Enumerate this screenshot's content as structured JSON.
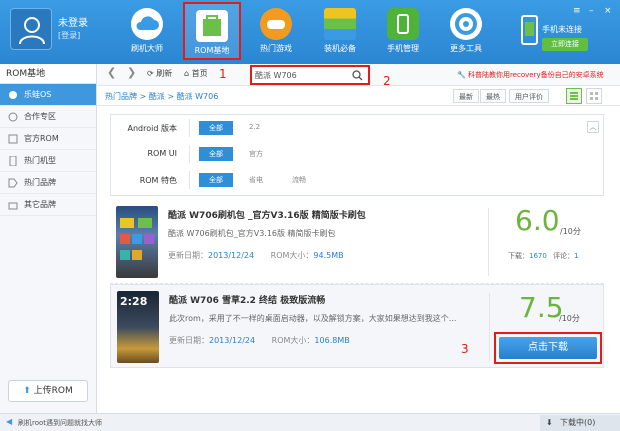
{
  "user": {
    "name": "未登录",
    "login": "[登录]"
  },
  "nav": [
    {
      "label": "刷机大师"
    },
    {
      "label": "ROM基地"
    },
    {
      "label": "热门游戏"
    },
    {
      "label": "装机必备"
    },
    {
      "label": "手机管理"
    },
    {
      "label": "更多工具"
    }
  ],
  "phone": {
    "status": "手机未连接",
    "connect": "立即连接"
  },
  "sidebar": {
    "title": "ROM基地",
    "items": [
      {
        "label": "乐蛙OS"
      },
      {
        "label": "合作专区"
      },
      {
        "label": "官方ROM"
      },
      {
        "label": "热门机型"
      },
      {
        "label": "热门品牌"
      },
      {
        "label": "其它品牌"
      }
    ],
    "upload": "上传ROM"
  },
  "toolbar": {
    "refresh": "刷新",
    "home": "首页",
    "search_value": "酷派 W706",
    "warning": "科普陆教你用recovery备份自己的安卓系统"
  },
  "annotations": {
    "n1": "1",
    "n2": "2",
    "n3": "3"
  },
  "breadcrumb": "热门品牌 > 酷派 > 酷派 W706",
  "sort": {
    "newest": "最新",
    "hottest": "最热",
    "rating": "用户评价"
  },
  "filter": {
    "rows": [
      {
        "label": "Android 版本",
        "selected": "全部",
        "options": [
          "2.2"
        ]
      },
      {
        "label": "ROM UI",
        "selected": "全部",
        "options": [
          "官方"
        ]
      },
      {
        "label": "ROM 特色",
        "selected": "全部",
        "options": [
          "省电",
          "流畅"
        ]
      }
    ]
  },
  "roms": [
    {
      "title": "酷派 W706刷机包 _官方V3.16版 精简版卡刷包",
      "desc": "酷派 W706刷机包_官方V3.16版 精简版卡刷包",
      "date_label": "更新日期：",
      "date": "2013/12/24",
      "size_label": "ROM大小：",
      "size": "94.5MB",
      "score": "6.0",
      "score_unit": "/10分",
      "downloads_label": "下载：",
      "downloads": "1670",
      "comments_label": "评论：",
      "comments": "1"
    },
    {
      "title": "酷派 W706 雪草2.2 终结 极致版流畅",
      "desc": "此次rom，采用了不一样的桌面启动器，以及解锁方案，大家如果想达到我这个...",
      "date_label": "更新日期：",
      "date": "2013/12/24",
      "size_label": "ROM大小：",
      "size": "106.8MB",
      "score": "7.5",
      "score_unit": "/10分",
      "download_btn": "点击下载",
      "thumb_time": "2:28"
    }
  ],
  "statusbar": {
    "text": "刷机root遇到问题就找大师",
    "downloading": "下载中(0)"
  },
  "colors": {
    "accent": "#2f8ed8",
    "highlight": "#e31b1b",
    "score": "#6db43c"
  }
}
